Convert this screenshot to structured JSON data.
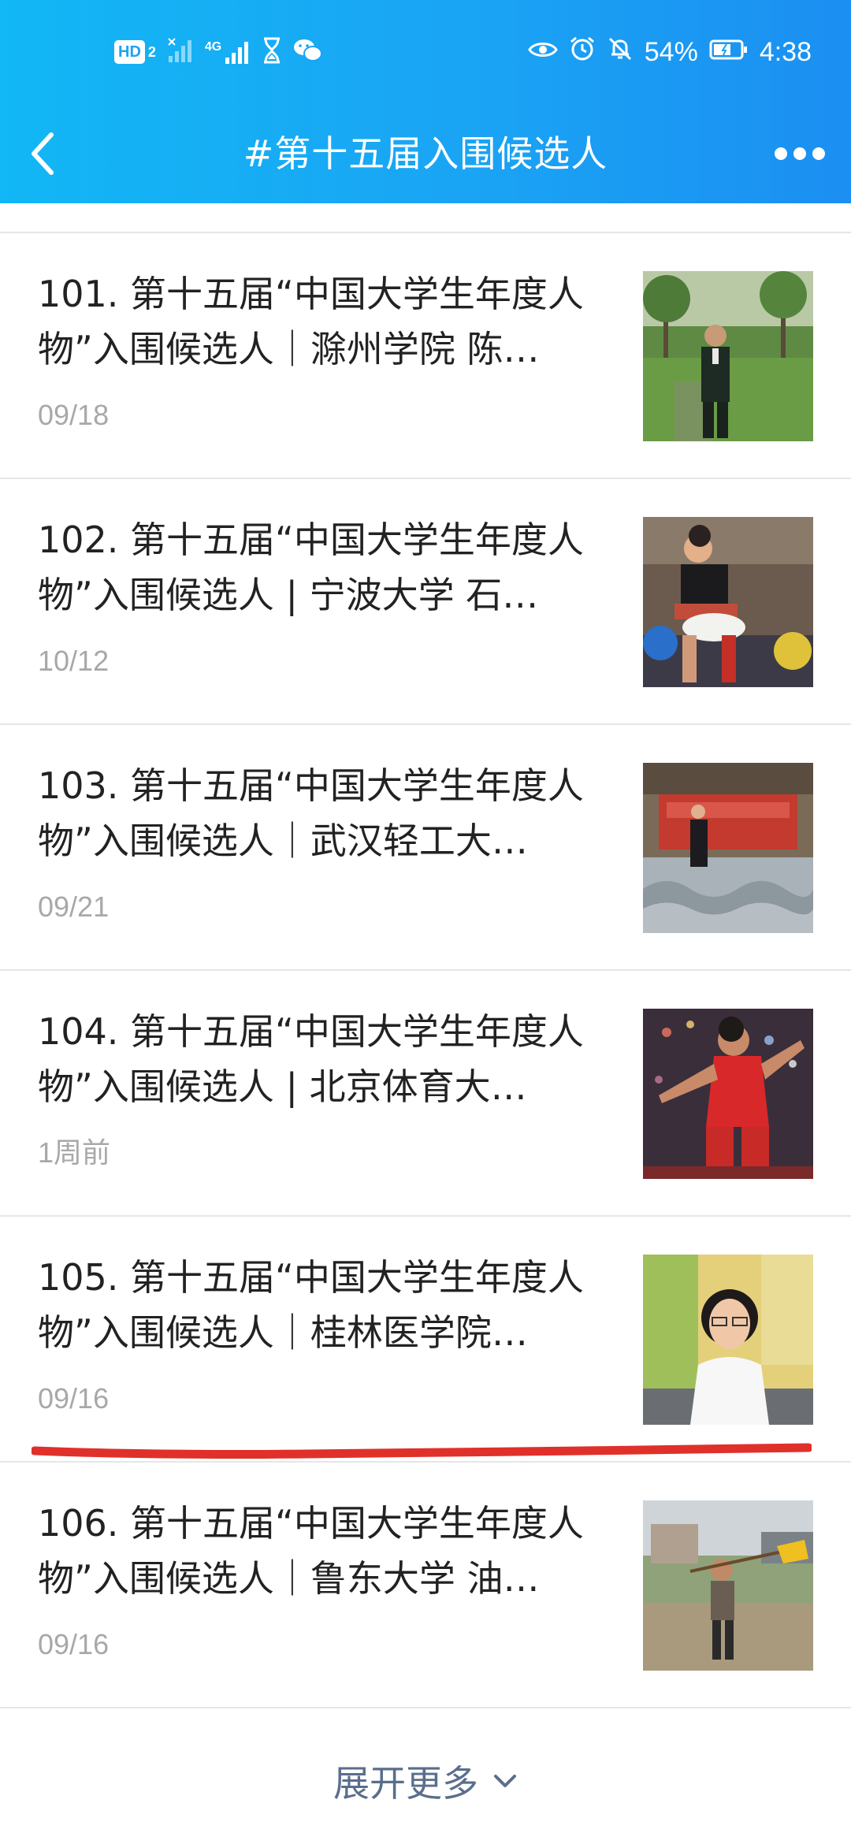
{
  "status_bar": {
    "hd_badge": "HD",
    "hd_sub": "2",
    "network": "4G",
    "battery_percent": "54%",
    "time": "4:38",
    "icons_left": [
      "hd-icon",
      "signal-icon",
      "4g-signal-icon",
      "hourglass-icon",
      "wechat-icon"
    ],
    "icons_right": [
      "eye-icon",
      "alarm-icon",
      "mute-icon",
      "battery-icon"
    ]
  },
  "nav": {
    "title": "#第十五届入围候选人"
  },
  "articles": [
    {
      "title": "101. 第十五届“中国大学生年度人物”入围候选人｜滁州学院 陈…",
      "date": "09/18"
    },
    {
      "title": "102. 第十五届“中国大学生年度人物”入围候选人 | 宁波大学 石…",
      "date": "10/12"
    },
    {
      "title": "103. 第十五届“中国大学生年度人物”入围候选人｜武汉轻工大…",
      "date": "09/21"
    },
    {
      "title": "104. 第十五届“中国大学生年度人物”入围候选人 | 北京体育大…",
      "date": "1周前"
    },
    {
      "title": "105. 第十五届“中国大学生年度人物”入围候选人｜桂林医学院…",
      "date": "09/16"
    },
    {
      "title": "106. 第十五届“中国大学生年度人物”入围候选人｜鲁东大学 油…",
      "date": "09/16"
    }
  ],
  "expand_more": {
    "label": "展开更多"
  },
  "colors": {
    "header_gradient_start": "#12b7f5",
    "header_gradient_end": "#1b8ff2",
    "date_gray": "#a8a8a8",
    "expand_link": "#5a6e8c",
    "annotation_red": "#e0302a"
  }
}
